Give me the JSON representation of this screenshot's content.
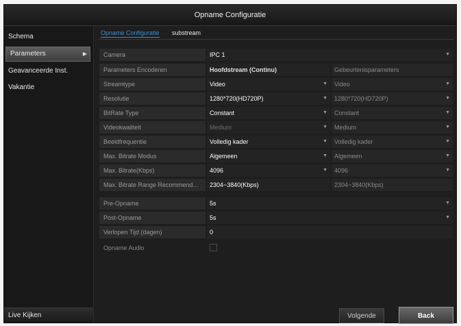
{
  "window": {
    "title": "Opname Configuratie"
  },
  "sidebar": {
    "items": [
      {
        "label": "Schema"
      },
      {
        "label": "Parameters"
      },
      {
        "label": "Geavanceerde Inst."
      },
      {
        "label": "Vakantie"
      }
    ],
    "bottom_label": "Live Kijken"
  },
  "tabs": [
    {
      "label": "Opname Configuratie"
    },
    {
      "label": "substream"
    }
  ],
  "form": {
    "camera": {
      "label": "Camera",
      "value": "IPC 1"
    },
    "header": {
      "label": "Parameters Encoderen",
      "main": "Hoofdstream (Continu)",
      "event": "Gebeurtenisparameters"
    },
    "rows": [
      {
        "label": "Streamtype",
        "main": "Video",
        "event": "Video"
      },
      {
        "label": "Resolutie",
        "main": "1280*720(HD720P)",
        "event": "1280*720(HD720P)"
      },
      {
        "label": "BitRate Type",
        "main": "Constant",
        "event": "Constant"
      },
      {
        "label": "Videokwaliteit",
        "main": "Medium",
        "event": "Medium"
      },
      {
        "label": "Beeldfrequentie",
        "main": "Volledig kader",
        "event": "Volledig kader"
      },
      {
        "label": "Max. Bitrate Modus",
        "main": "Algemeen",
        "event": "Algemeen"
      },
      {
        "label": "Max. Bitrate(Kbps)",
        "main": "4096",
        "event": "4096"
      },
      {
        "label": "Max. Bitrate Range Recommend...",
        "main": "2304~3840(Kbps)",
        "event": "2304~3840(Kbps)"
      }
    ],
    "pre_record": {
      "label": "Pre-Opname",
      "value": "5s"
    },
    "post_record": {
      "label": "Post-Opname",
      "value": "5s"
    },
    "expired": {
      "label": "Verlopen Tijd (dagen)",
      "value": "0"
    },
    "audio": {
      "label": "Opname Audio"
    }
  },
  "buttons": {
    "next": "Volgende",
    "back": "Back"
  }
}
